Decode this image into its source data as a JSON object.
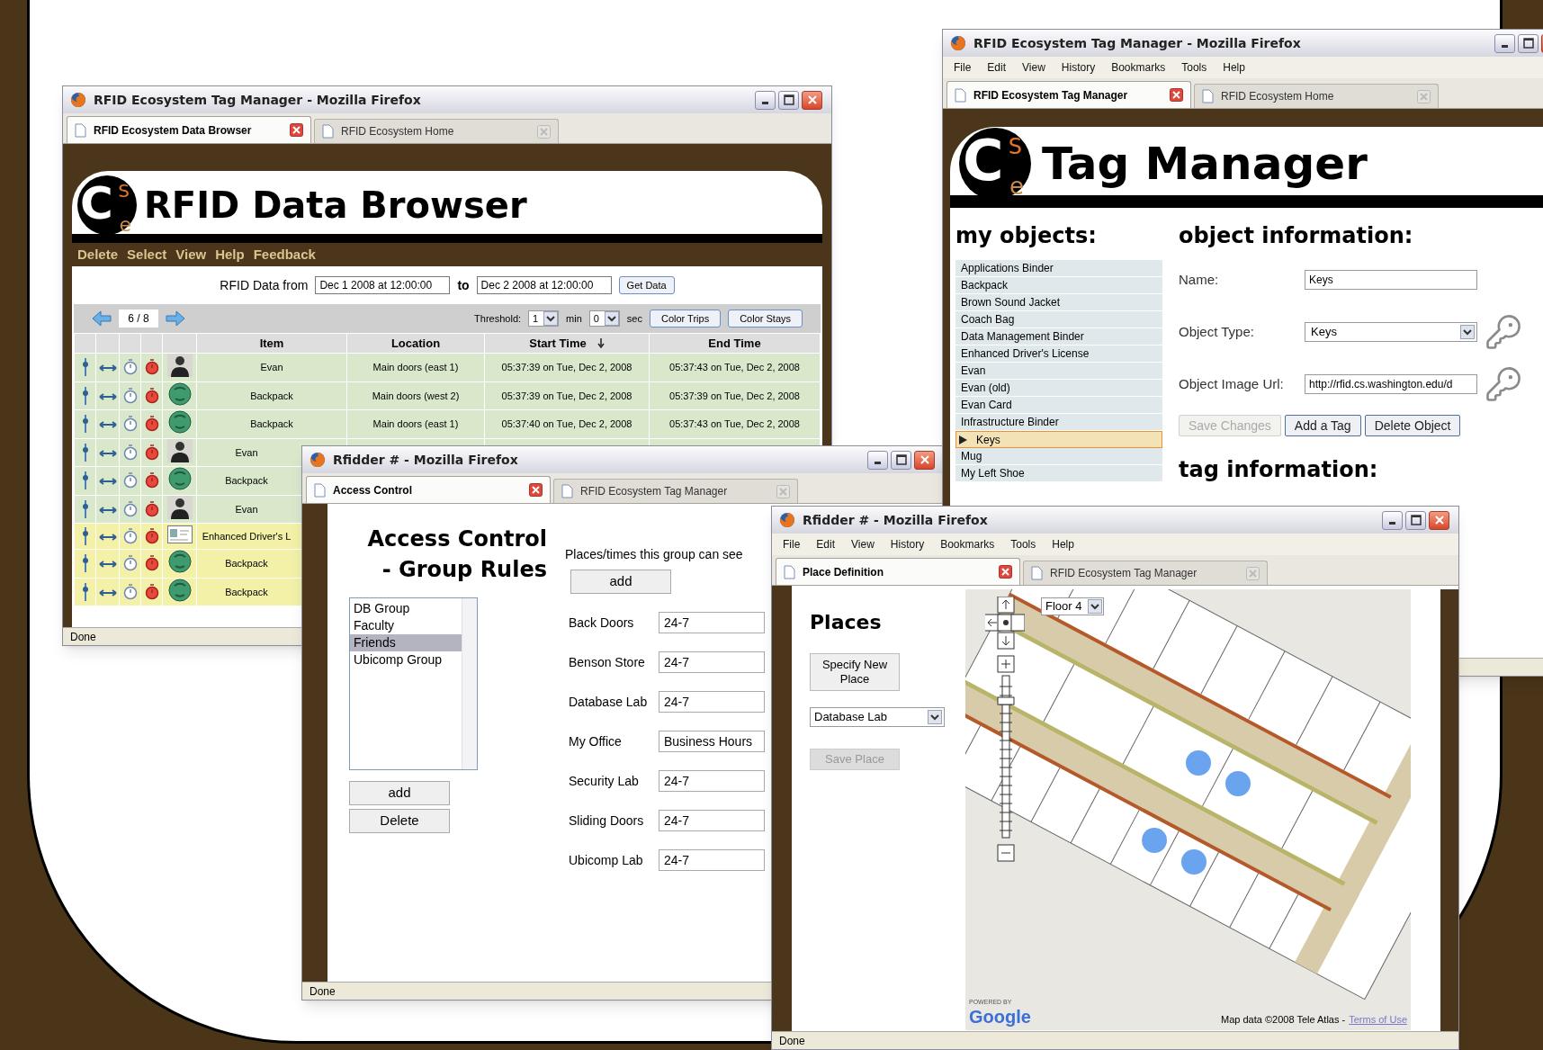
{
  "data_browser": {
    "title": "RFID Ecosystem Tag Manager - Mozilla Firefox",
    "tabs": [
      {
        "label": "RFID Ecosystem Data Browser",
        "selected": true
      },
      {
        "label": "RFID Ecosystem Home",
        "selected": false
      }
    ],
    "logo": [
      "C",
      "S",
      "e"
    ],
    "heading": "RFID Data Browser",
    "page_menu": [
      "Delete",
      "Select",
      "View",
      "Help",
      "Feedback"
    ],
    "range": {
      "label": "RFID Data from",
      "from": "Dec 1 2008 at 12:00:00",
      "to_label": "to",
      "to": "Dec 2 2008 at 12:00:00",
      "button": "Get Data"
    },
    "pager": "6 / 8",
    "threshold": {
      "label": "Threshold:",
      "minutes": "1",
      "min_unit": "min",
      "seconds": "0",
      "sec_unit": "sec"
    },
    "buttons": [
      "Color Trips",
      "Color Stays"
    ],
    "columns": [
      "Item",
      "Location",
      "Start Time",
      "End Time"
    ],
    "rows": [
      {
        "kind": "person",
        "item": "Evan",
        "location": "Main doors (east 1)",
        "start": "05:37:39 on Tue, Dec 2, 2008",
        "end": "05:37:43 on Tue, Dec 2, 2008",
        "highlighted": false
      },
      {
        "kind": "backpack",
        "item": "Backpack",
        "location": "Main doors (west 2)",
        "start": "05:37:39 on Tue, Dec 2, 2008",
        "end": "05:37:39 on Tue, Dec 2, 2008",
        "highlighted": false
      },
      {
        "kind": "backpack",
        "item": "Backpack",
        "location": "Main doors (east 1)",
        "start": "05:37:40 on Tue, Dec 2, 2008",
        "end": "05:37:43 on Tue, Dec 2, 2008",
        "highlighted": false
      },
      {
        "kind": "person",
        "item": "Evan",
        "highlighted": false
      },
      {
        "kind": "backpack",
        "item": "Backpack",
        "highlighted": false
      },
      {
        "kind": "person",
        "item": "Evan",
        "highlighted": false
      },
      {
        "kind": "card",
        "item": "Enhanced Driver's L",
        "highlighted": true
      },
      {
        "kind": "backpack",
        "item": "Backpack",
        "highlighted": true
      },
      {
        "kind": "backpack",
        "item": "Backpack",
        "highlighted": true
      }
    ],
    "status": "Done"
  },
  "access_control": {
    "title": "Rfidder # - Mozilla Firefox",
    "tabs": [
      {
        "label": "Access Control",
        "selected": true
      },
      {
        "label": "RFID Ecosystem Tag Manager",
        "selected": false
      }
    ],
    "heading": [
      "Access Control",
      "- Group Rules"
    ],
    "groups": [
      {
        "label": "DB Group",
        "selected": false
      },
      {
        "label": "Faculty",
        "selected": false
      },
      {
        "label": "Friends",
        "selected": true
      },
      {
        "label": "Ubicomp Group",
        "selected": false
      }
    ],
    "group_buttons": [
      "add",
      "Delete"
    ],
    "places_label": "Places/times this group can see",
    "places_add": "add",
    "places": [
      {
        "label": "Back Doors",
        "value": "24-7"
      },
      {
        "label": "Benson Store",
        "value": "24-7"
      },
      {
        "label": "Database Lab",
        "value": "24-7"
      },
      {
        "label": "My Office",
        "value": "Business Hours"
      },
      {
        "label": "Security Lab",
        "value": "24-7"
      },
      {
        "label": "Sliding Doors",
        "value": "24-7"
      },
      {
        "label": "Ubicomp Lab",
        "value": "24-7"
      }
    ],
    "status": "Done"
  },
  "tag_manager": {
    "title": "RFID Ecosystem Tag Manager - Mozilla Firefox",
    "menu": [
      "File",
      "Edit",
      "View",
      "History",
      "Bookmarks",
      "Tools",
      "Help"
    ],
    "tabs": [
      {
        "label": "RFID Ecosystem Tag Manager",
        "selected": true
      },
      {
        "label": "RFID Ecosystem Home",
        "selected": false
      }
    ],
    "logo": [
      "C",
      "S",
      "e"
    ],
    "heading": "Tag Manager",
    "objects_heading": "my objects:",
    "objects": [
      {
        "label": "Applications Binder",
        "selected": false
      },
      {
        "label": "Backpack",
        "selected": false
      },
      {
        "label": "Brown Sound Jacket",
        "selected": false
      },
      {
        "label": "Coach Bag",
        "selected": false
      },
      {
        "label": "Data Management Binder",
        "selected": false
      },
      {
        "label": "Enhanced Driver's License",
        "selected": false
      },
      {
        "label": "Evan",
        "selected": false
      },
      {
        "label": "Evan (old)",
        "selected": false
      },
      {
        "label": "Evan Card",
        "selected": false
      },
      {
        "label": "Infrastructure Binder",
        "selected": false
      },
      {
        "label": "Keys",
        "selected": true
      },
      {
        "label": "Mug",
        "selected": false
      },
      {
        "label": "My Left Shoe",
        "selected": false
      }
    ],
    "info_heading": "object information:",
    "fields": [
      {
        "kind": "text",
        "label": "Name:",
        "value": "Keys"
      },
      {
        "kind": "select",
        "label": "Object Type:",
        "value": "Keys"
      },
      {
        "kind": "text",
        "label": "Object Image Url:",
        "value": "http://rfid.cs.washington.edu/d"
      }
    ],
    "buttons": [
      {
        "label": "Save Changes",
        "disabled": true
      },
      {
        "label": "Add a Tag",
        "disabled": false
      },
      {
        "label": "Delete Object",
        "disabled": false
      }
    ],
    "tag_heading": "tag information:"
  },
  "place_definition": {
    "title": "Rfidder # - Mozilla Firefox",
    "menu": [
      "File",
      "Edit",
      "View",
      "History",
      "Bookmarks",
      "Tools",
      "Help"
    ],
    "tabs": [
      {
        "label": "Place Definition",
        "selected": true
      },
      {
        "label": "RFID Ecosystem Tag Manager",
        "selected": false
      }
    ],
    "heading": "Places",
    "specify_button": "Specify New Place",
    "place_select": "Database Lab",
    "save_button": {
      "label": "Save Place",
      "disabled": true
    },
    "map": {
      "floor": "Floor 4",
      "powered_by": "POWERED BY",
      "logo": "Google",
      "attribution": "Map data ©2008 Tele Atlas -",
      "terms_link": "Terms of Use"
    },
    "status": "Done"
  }
}
